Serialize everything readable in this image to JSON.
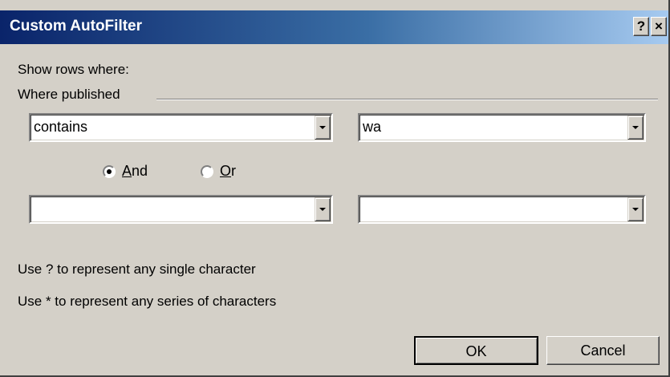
{
  "dialog": {
    "title": "Custom AutoFilter",
    "help_button": "?",
    "close_button": "×"
  },
  "criteria": {
    "show_rows_label": "Show rows where:",
    "field_name": "Where published",
    "row1": {
      "operator": "contains",
      "value": "wa"
    },
    "row2": {
      "operator": "",
      "value": ""
    }
  },
  "logic": {
    "and_label_u": "A",
    "and_label_rest": "nd",
    "or_label_u": "O",
    "or_label_rest": "r",
    "selected": "And"
  },
  "hints": {
    "single_char": "Use ? to represent any single character",
    "series_chars": "Use * to represent any series of characters"
  },
  "buttons": {
    "ok": "OK",
    "cancel": "Cancel"
  }
}
